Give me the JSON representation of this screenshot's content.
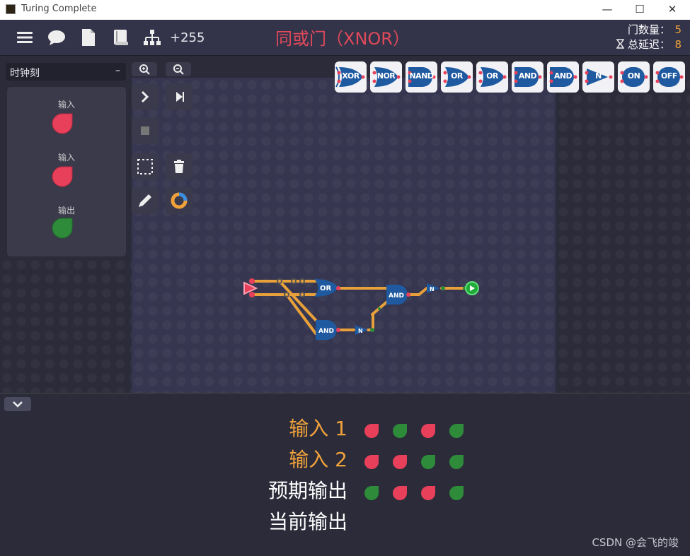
{
  "window": {
    "title": "Turing Complete",
    "controls": {
      "minimize": "—",
      "maximize": "☐",
      "close": "✕"
    }
  },
  "toolbar": {
    "coins": "+255",
    "level_title": "同或门（XNOR）"
  },
  "stats": {
    "gate_count_label": "门数量：",
    "gate_count": "5",
    "delay_label": "总延迟：",
    "delay": "8"
  },
  "sidebar": {
    "title": "时钟刻",
    "collapse": "–",
    "components": [
      {
        "label": "输入",
        "color": "#e8405a"
      },
      {
        "label": "输入",
        "color": "#e8405a"
      },
      {
        "label": "输出",
        "color": "#2e8b3a"
      }
    ]
  },
  "palette": [
    {
      "label": "XOR",
      "kind": "xor"
    },
    {
      "label": "NOR",
      "kind": "or"
    },
    {
      "label": "NAND",
      "kind": "and"
    },
    {
      "label": "OR",
      "kind": "or"
    },
    {
      "label": "OR",
      "kind": "or"
    },
    {
      "label": "AND",
      "kind": "and"
    },
    {
      "label": "AND",
      "kind": "and"
    },
    {
      "label": "N",
      "kind": "not"
    },
    {
      "label": "ON",
      "kind": "on"
    },
    {
      "label": "OFF",
      "kind": "off"
    }
  ],
  "circuit": {
    "or_label": "OR",
    "and1_label": "AND",
    "and2_label": "AND",
    "not1_label": "N",
    "not2_label": "N"
  },
  "truth_table": {
    "rows": [
      {
        "label": "输入 1",
        "color": "#f0a23a",
        "values": [
          "off",
          "on",
          "off",
          "on"
        ]
      },
      {
        "label": "输入 2",
        "color": "#f0a23a",
        "values": [
          "off",
          "off",
          "on",
          "on"
        ]
      },
      {
        "label": "预期输出",
        "color": "#ffffff",
        "values": [
          "on",
          "off",
          "off",
          "on"
        ]
      },
      {
        "label": "当前输出",
        "color": "#ffffff",
        "values": []
      }
    ],
    "colors": {
      "on": "#2e8b3a",
      "off": "#e8405a"
    }
  },
  "watermark": "CSDN @会飞的竣",
  "colors": {
    "accent": "#f0a23a",
    "title_red": "#e04a5a",
    "gate_blue": "#1f5aa0",
    "wire": "#e8a13a"
  }
}
